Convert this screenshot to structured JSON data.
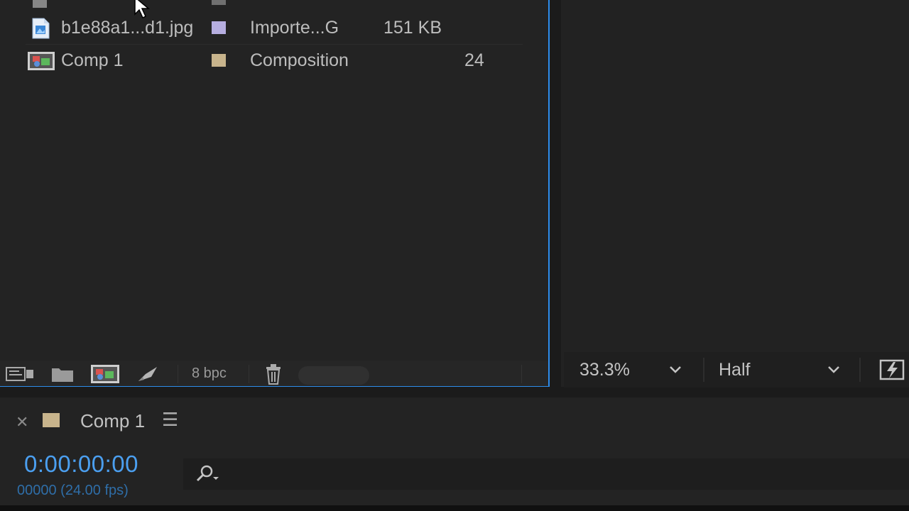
{
  "project": {
    "rows": [
      {
        "name": "",
        "type": "",
        "size": "",
        "frames": "",
        "swatch": "#b0b0b0"
      },
      {
        "name": "b1e88a1...d1.jpg",
        "type": "Importe...G",
        "size": "151 KB",
        "frames": "",
        "swatch": "#b6aee0"
      },
      {
        "name": "Comp 1",
        "type": "Composition",
        "size": "",
        "frames": "24",
        "swatch": "#c8b48c"
      }
    ],
    "footer": {
      "bpc": "8 bpc"
    }
  },
  "viewer": {
    "zoom": "33.3%",
    "resolution": "Half"
  },
  "timeline": {
    "tab_title": "Comp 1",
    "timecode": "0:00:00:00",
    "frame_fps": "00000 (24.00 fps)"
  },
  "colors": {
    "accent": "#2d8ceb",
    "timecode": "#4b9ff0",
    "comp_swatch": "#c8b48c"
  }
}
